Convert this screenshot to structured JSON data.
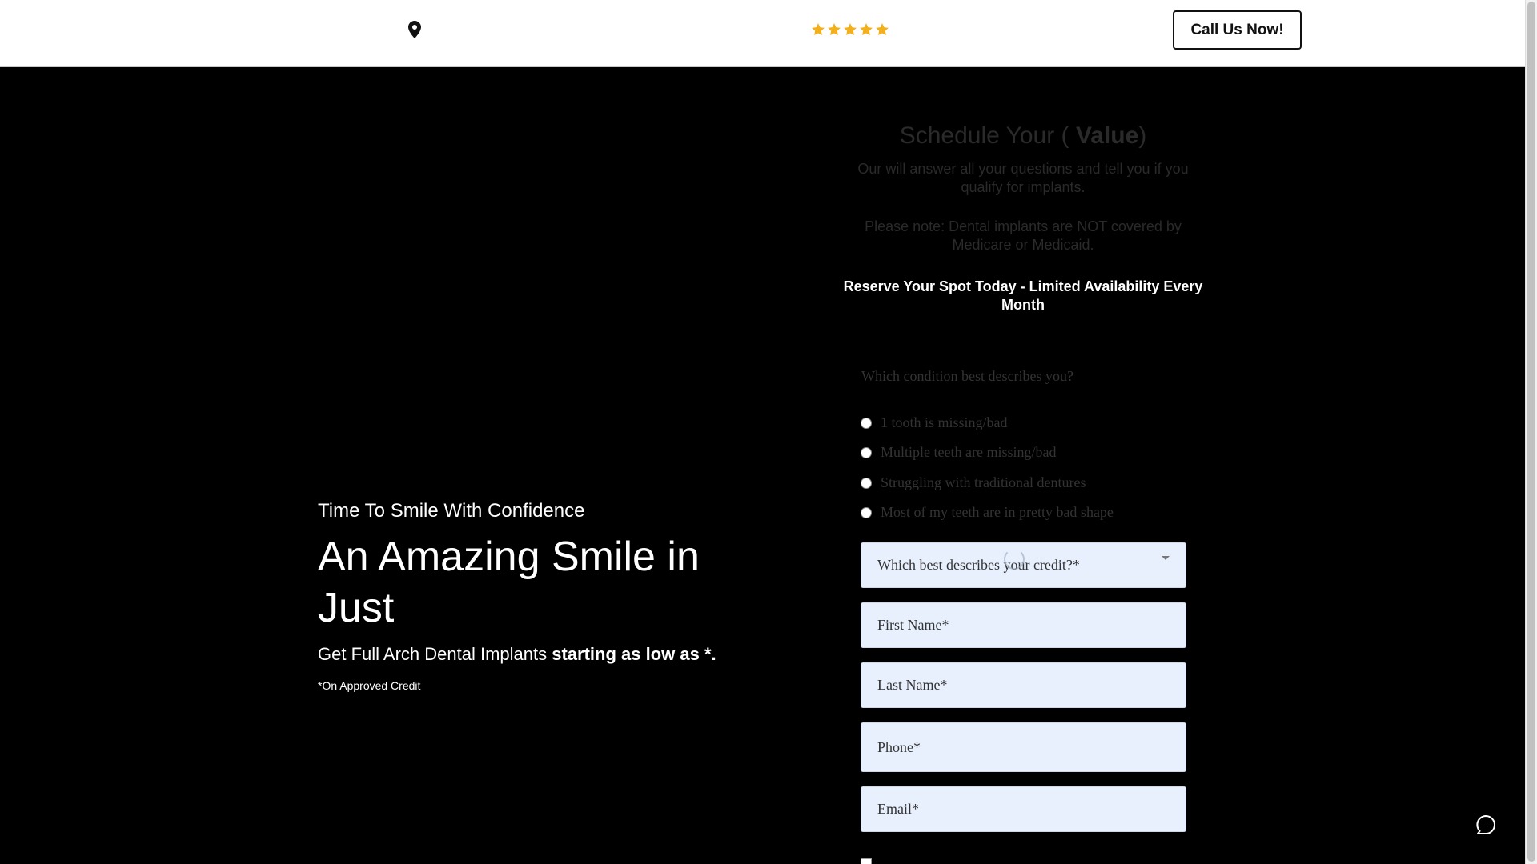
{
  "header": {
    "location_icon": "map-pin-icon",
    "rating_stars": 5,
    "call_button_label": "Call Us Now!"
  },
  "hero": {
    "eyebrow": "Time To Smile With Confidence",
    "title": "An Amazing Smile in Just",
    "subtitle_prefix": "Get Full Arch Dental Implants ",
    "subtitle_bold": "starting as low as *.",
    "disclaimer": "*On Approved Credit"
  },
  "form": {
    "title_prefix": "Schedule Your ( ",
    "title_bold": "Value",
    "title_suffix": ")",
    "description": "Our will answer all your questions and tell you if you qualify for implants.",
    "note": "Please note: Dental implants are NOT covered by Medicare or Medicaid.",
    "reserve": "Reserve Your Spot Today - Limited Availability Every Month",
    "question": "Which condition best describes you?",
    "options": [
      "1 tooth is missing/bad",
      "Multiple teeth are missing/bad",
      "Struggling with traditional dentures",
      "Most of my teeth are in pretty bad shape"
    ],
    "credit_placeholder": "Which best describes your credit?*",
    "first_name_placeholder": "First Name*",
    "last_name_placeholder": "Last Name*",
    "phone_placeholder": "Phone*",
    "email_placeholder": "Email*"
  },
  "icons": {
    "chat": "chat-bubble-icon",
    "star": "star-icon"
  },
  "colors": {
    "star": "#f2b01e",
    "field_bg": "#e8f0fe",
    "page_bg": "#000000"
  }
}
